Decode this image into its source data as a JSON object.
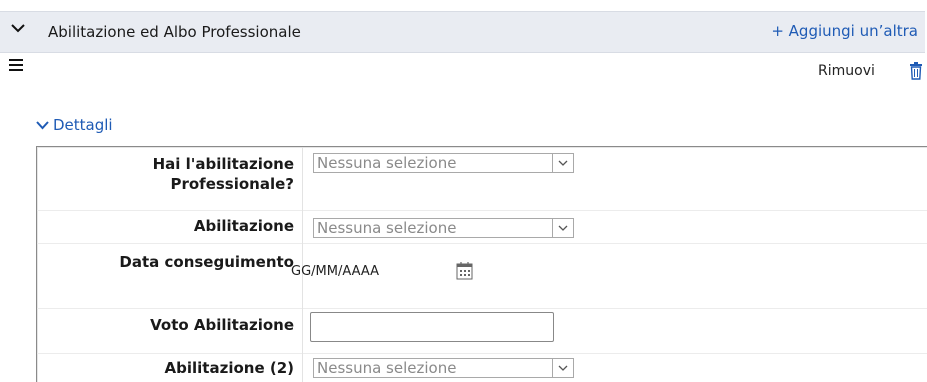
{
  "section": {
    "title": "Abilitazione ed Albo Professionale",
    "add_link": "+ Aggiungi un’altra"
  },
  "toolbar": {
    "remove_label": "Rimuovi"
  },
  "details": {
    "toggle_label": "Dettagli"
  },
  "form": {
    "professional_license": {
      "label_line1": "Hai l'abilitazione",
      "label_line2": "Professionale?",
      "value": "Nessuna selezione"
    },
    "license": {
      "label": "Abilitazione",
      "value": "Nessuna selezione"
    },
    "date_obtained": {
      "label": "Data conseguimento",
      "placeholder": "GG/MM/AAAA"
    },
    "license_grade": {
      "label": "Voto Abilitazione",
      "value": ""
    },
    "license_2": {
      "label": "Abilitazione (2)",
      "value": "Nessuna selezione"
    }
  },
  "colors": {
    "link": "#1f5bb5",
    "header_bg": "#e9ecf2",
    "placeholder_text": "#8a8a8a"
  },
  "icons": [
    "chevron-down-icon",
    "hamburger-menu-icon",
    "trash-icon",
    "calendar-icon"
  ]
}
